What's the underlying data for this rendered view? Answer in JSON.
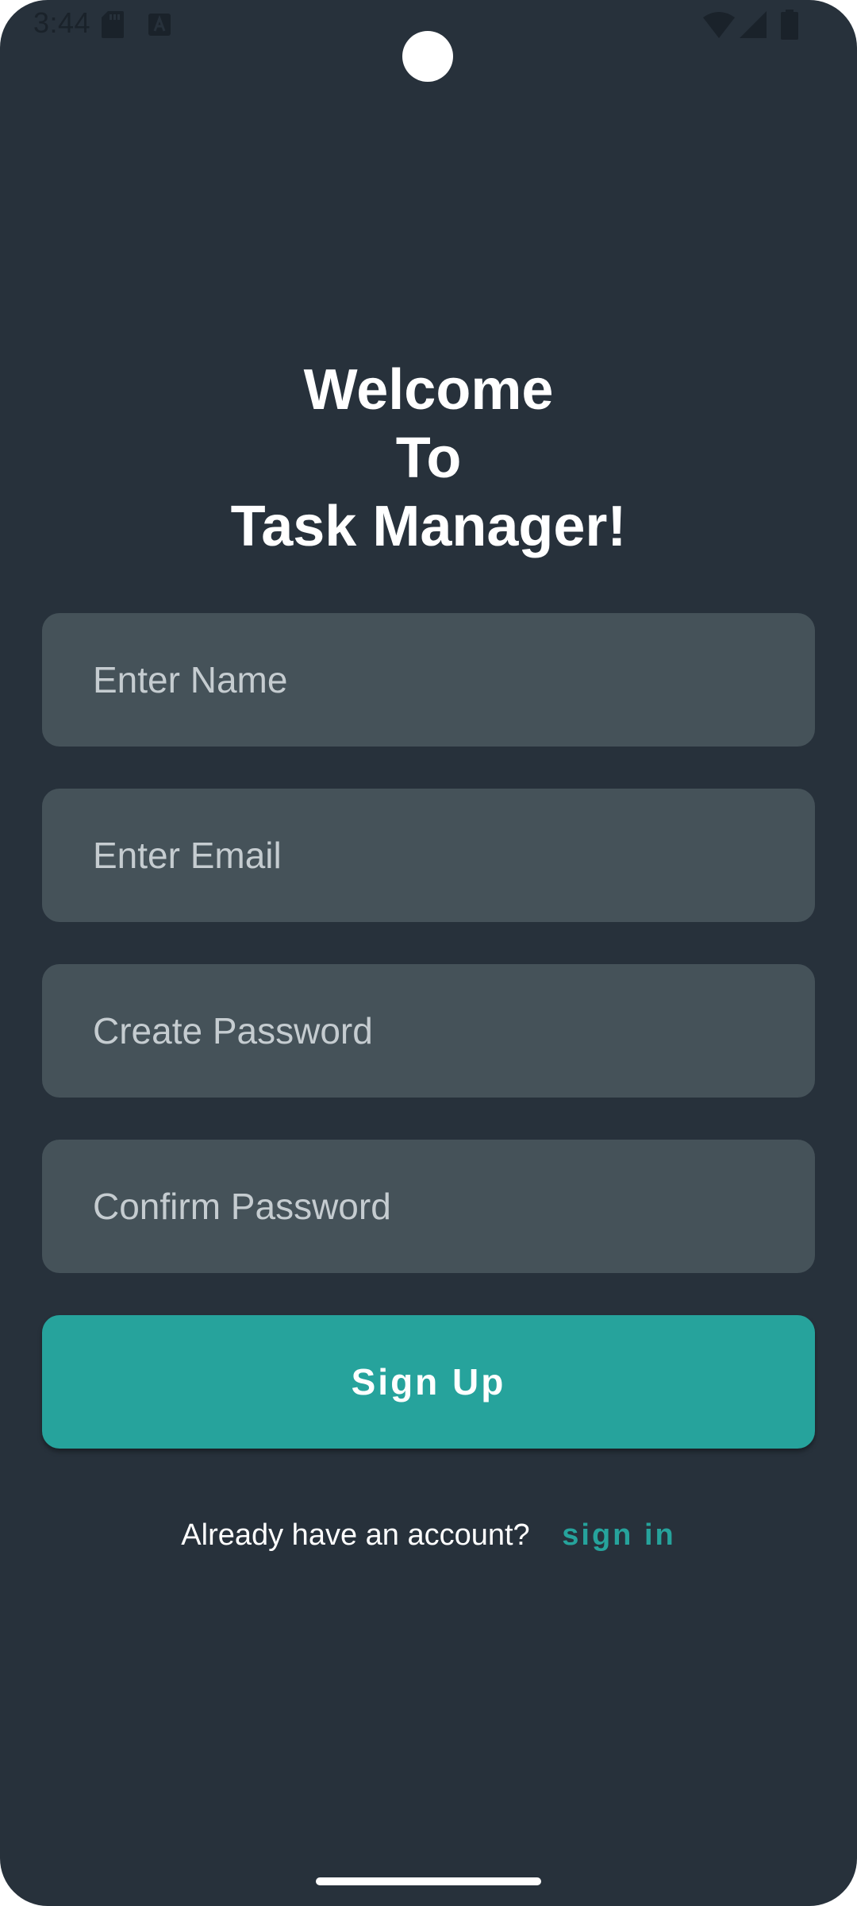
{
  "status_bar": {
    "time": "3:44",
    "icons": [
      "sd-card-icon",
      "a-icon",
      "wifi-icon",
      "signal-icon",
      "battery-icon"
    ]
  },
  "title": {
    "line1": "Welcome",
    "line2": "To",
    "line3": "Task Manager!"
  },
  "form": {
    "name_placeholder": "Enter Name",
    "email_placeholder": "Enter Email",
    "password_placeholder": "Create Password",
    "confirm_placeholder": "Confirm Password",
    "submit_label": "Sign Up"
  },
  "footer": {
    "prompt": "Already have an account?",
    "link_label": "sign in"
  },
  "colors": {
    "background": "#27313b",
    "field": "#455259",
    "accent": "#26a39c",
    "text": "#ffffff"
  }
}
